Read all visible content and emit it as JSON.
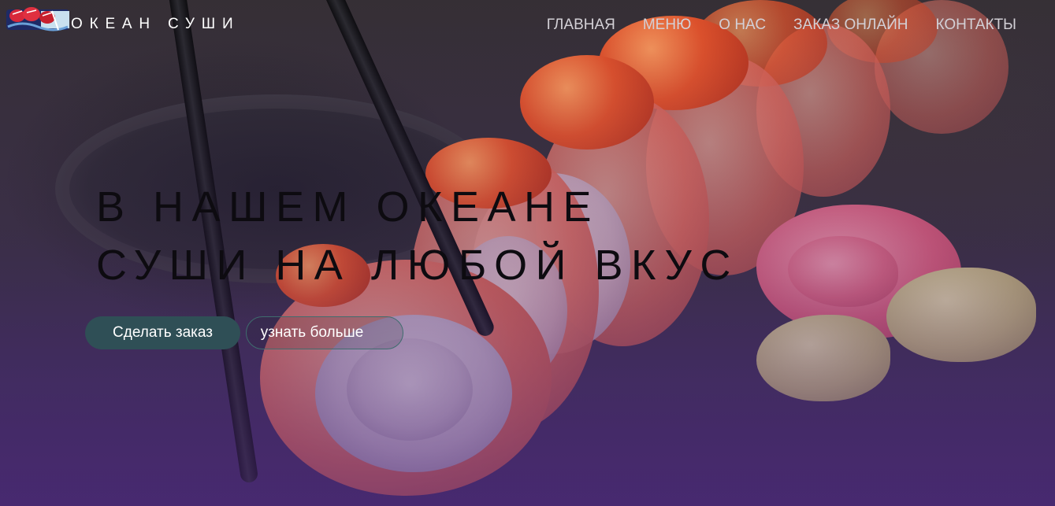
{
  "header": {
    "brand": "ОКЕАН СУШИ",
    "logo_icon": "sushi-logo-icon",
    "nav": [
      {
        "label": "ГЛАВНАЯ"
      },
      {
        "label": "МЕНЮ"
      },
      {
        "label": "О НАС"
      },
      {
        "label": "ЗАКАЗ ОНЛАЙН"
      },
      {
        "label": "КОНТАКТЫ"
      }
    ]
  },
  "hero": {
    "headline_line1": "В НАШЕМ ОКЕАНЕ",
    "headline_line2": "СУШИ НА ЛЮБОЙ ВКУС",
    "primary_button": "Сделать заказ",
    "secondary_button": "узнать больше"
  },
  "colors": {
    "primary_button_bg": "#2f4f56",
    "secondary_button_border": "#3f6d6e",
    "headline": "#0d0b10",
    "nav_text": "#d3d0d6",
    "overlay_purple": "#4b2878"
  }
}
